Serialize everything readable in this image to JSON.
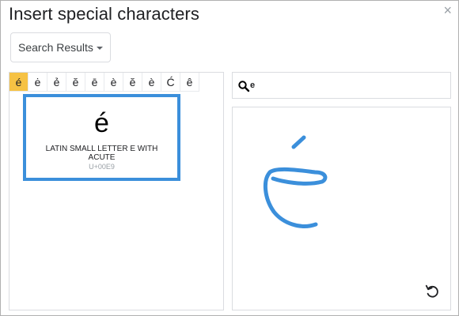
{
  "dialog": {
    "title": "Insert special characters",
    "close_label": "×"
  },
  "category_dropdown": {
    "selected": "Search Results"
  },
  "results": [
    {
      "char": "é",
      "selected": true
    },
    {
      "char": "ė",
      "selected": false
    },
    {
      "char": "ẻ",
      "selected": false
    },
    {
      "char": "ĕ",
      "selected": false
    },
    {
      "char": "ē",
      "selected": false
    },
    {
      "char": "è",
      "selected": false
    },
    {
      "char": "ĕ",
      "selected": false
    },
    {
      "char": "è",
      "selected": false
    },
    {
      "char": "Ć",
      "selected": false
    },
    {
      "char": "ê",
      "selected": false
    }
  ],
  "preview": {
    "char": "é",
    "name": "LATIN SMALL LETTER E WITH ACUTE",
    "code": "U+00E9"
  },
  "search": {
    "value": "e",
    "icon": "search-icon"
  },
  "draw_panel": {
    "stroke_color": "#3b8fdb",
    "undo_icon": "undo-icon"
  },
  "colors": {
    "selected_cell": "#f6c244",
    "tooltip_border": "#3b8fdb"
  }
}
